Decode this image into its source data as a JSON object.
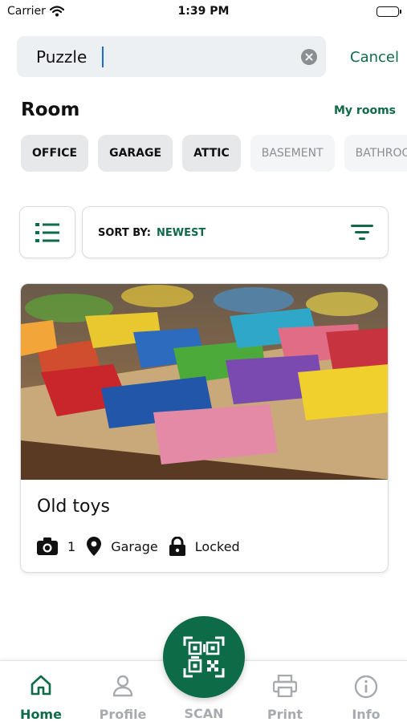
{
  "status_bar": {
    "carrier": "Carrier",
    "time": "1:39 PM"
  },
  "search": {
    "value": "Puzzle",
    "cancel_label": "Cancel"
  },
  "room_section": {
    "title": "Room",
    "link": "My rooms",
    "chips": [
      {
        "label": "OFFICE",
        "state": "active"
      },
      {
        "label": "GARAGE",
        "state": "active"
      },
      {
        "label": "ATTIC",
        "state": "active"
      },
      {
        "label": "BASEMENT",
        "state": "inactive"
      },
      {
        "label": "BATHROOM",
        "state": "inactive"
      }
    ]
  },
  "sort": {
    "label": "SORT BY:",
    "value": "NEWEST"
  },
  "card": {
    "title": "Old toys",
    "photo_count": "1",
    "location": "Garage",
    "status": "Locked",
    "photo_icon": "camera-icon",
    "location_icon": "map-pin-icon",
    "status_icon": "lock-icon"
  },
  "tabs": [
    {
      "label": "Home",
      "icon": "home-icon",
      "active": true
    },
    {
      "label": "Profile",
      "icon": "person-icon",
      "active": false
    },
    {
      "label": "SCAN",
      "icon": "qr-code-icon",
      "active": false
    },
    {
      "label": "Print",
      "icon": "printer-icon",
      "active": false
    },
    {
      "label": "Info",
      "icon": "info-icon",
      "active": false
    }
  ],
  "colors": {
    "accent": "#0f6b47",
    "chip_bg": "#e6e8ea",
    "inactive_text": "#a7abaf"
  }
}
